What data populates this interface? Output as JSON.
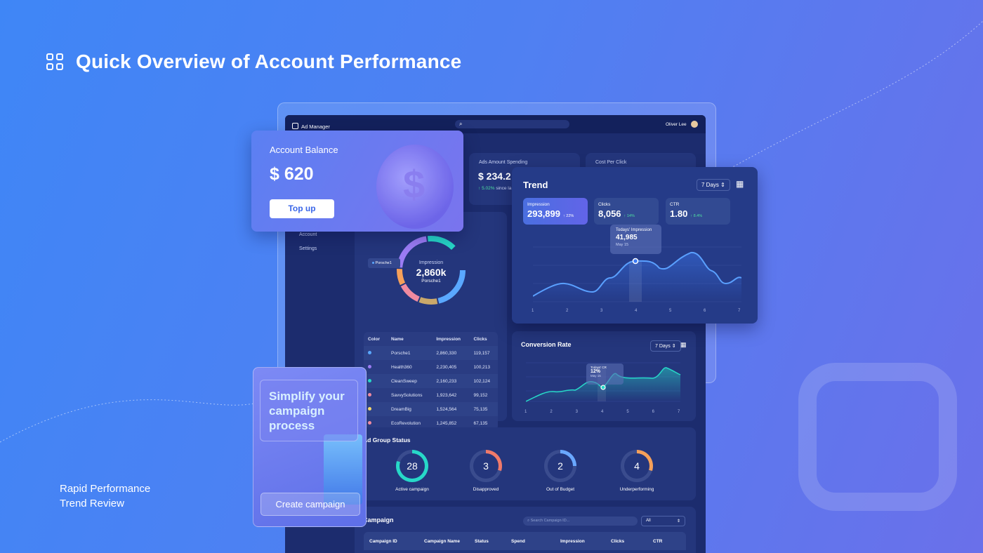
{
  "page": {
    "title": "Quick Overview of Account Performance",
    "tagline": [
      "Rapid Performance",
      "Trend Review"
    ]
  },
  "app": {
    "name": "Ad Manager",
    "user": "Oliver Lee",
    "sidebar": [
      "Account",
      "Settings"
    ]
  },
  "balance": {
    "label": "Account Balance",
    "value": "$ 620",
    "button": "Top up"
  },
  "spending": {
    "label": "Ads Amount Spending",
    "value": "$ 234.2",
    "change": "5.02%",
    "change_text": "since la"
  },
  "cpc": {
    "label": "Cost Per Click"
  },
  "trend": {
    "title": "Trend",
    "range": "7 Days",
    "kpis": [
      {
        "label": "Impression",
        "value": "293,899",
        "change": "22%"
      },
      {
        "label": "Clicks",
        "value": "8,056",
        "change": "14%"
      },
      {
        "label": "CTR",
        "value": "1.80",
        "change": "8.4%"
      }
    ],
    "tooltip": {
      "label": "Todays' Impression",
      "value": "41,985",
      "date": "May 15"
    },
    "x": [
      "1",
      "2",
      "3",
      "4",
      "5",
      "6",
      "7"
    ]
  },
  "conversion": {
    "title": "Conversion Rate",
    "range": "7 Days",
    "tooltip": {
      "label": "Todays' CR",
      "value": "12%",
      "date": "May 15"
    },
    "x": [
      "1",
      "2",
      "3",
      "4",
      "5",
      "6",
      "7"
    ]
  },
  "donut": {
    "label": "Impression",
    "value": "2,860k",
    "name": "Porsche1",
    "tag": "Porsche1"
  },
  "table": {
    "headers": [
      "Color",
      "Name",
      "Impression",
      "Clicks"
    ],
    "rows": [
      {
        "color": "#5aa8ff",
        "name": "Porsche1",
        "impression": "2,860,330",
        "clicks": "119,157"
      },
      {
        "color": "#9b7cf4",
        "name": "Health360",
        "impression": "2,230,405",
        "clicks": "100,213"
      },
      {
        "color": "#27d8c8",
        "name": "CleanSweep",
        "impression": "2,160,233",
        "clicks": "102,124"
      },
      {
        "color": "#f08aa0",
        "name": "SavvySolutions",
        "impression": "1,923,642",
        "clicks": "99,152"
      },
      {
        "color": "#f5d86a",
        "name": "DreamBig",
        "impression": "1,524,564",
        "clicks": "75,135"
      },
      {
        "color": "#f08aa0",
        "name": "EcoRevolution",
        "impression": "1,245,852",
        "clicks": "67,135"
      }
    ]
  },
  "adgroup": {
    "title": "Ad Group Status",
    "items": [
      {
        "value": "28",
        "label": "Active campaign",
        "color": "#27d8c8"
      },
      {
        "value": "3",
        "label": "Disapproved",
        "color": "#f07a6a"
      },
      {
        "value": "2",
        "label": "Out of Budget",
        "color": "#6aa8ff"
      },
      {
        "value": "4",
        "label": "Underperforming",
        "color": "#f5a05a"
      }
    ]
  },
  "campaign": {
    "title": "Campaign",
    "search_placeholder": "Search Campaign ID...",
    "filter": "All",
    "headers": [
      "Campaign ID",
      "Campaign Name",
      "Status",
      "Spend",
      "Impression",
      "Clicks",
      "CTR"
    ]
  },
  "promo": {
    "text": "Simplify your campaign process",
    "button": "Create campaign"
  }
}
